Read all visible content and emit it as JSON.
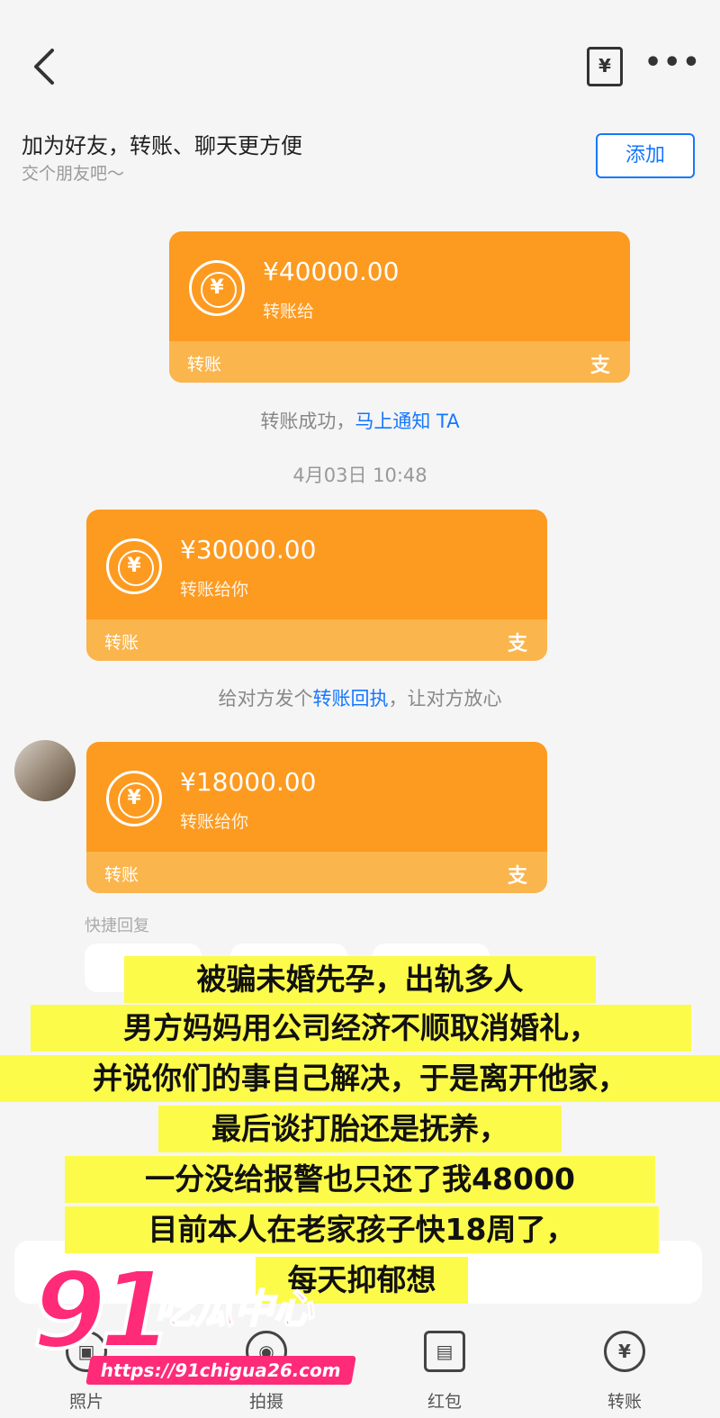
{
  "header": {
    "back_icon": "chevron-left-icon",
    "bill_icon_glyph": "¥",
    "more_glyph": "•••"
  },
  "friend_bar": {
    "title": "加为好友，转账、聊天更方便",
    "subtitle": "交个朋友吧～",
    "add_label": "添加"
  },
  "transfers": [
    {
      "amount": "¥40000.00",
      "desc": "转账给",
      "label": "转账",
      "badge": "支"
    },
    {
      "amount": "¥30000.00",
      "desc": "转账给你",
      "label": "转账",
      "badge": "支"
    },
    {
      "amount": "¥18000.00",
      "desc": "转账给你",
      "label": "转账",
      "badge": "支"
    }
  ],
  "system": {
    "success_text": "转账成功，",
    "notify_link": "马上通知 TA",
    "timestamp": "4月03日 10:48",
    "receipt_prefix": "给对方发个",
    "receipt_link": "转账回执",
    "receipt_suffix": "，让对方放心"
  },
  "quick_reply_label": "快捷回复",
  "bottom_nav": [
    {
      "icon": "photo-icon",
      "label": "照片"
    },
    {
      "icon": "camera-icon",
      "label": "拍摄"
    },
    {
      "icon": "red-packet-icon",
      "label": "红包"
    },
    {
      "icon": "transfer-icon",
      "label": "转账"
    }
  ],
  "overlay_lines": [
    "被骗未婚先孕，出轨多人",
    "男方妈妈用公司经济不顺取消婚礼，",
    "并说你们的事自己解决，于是离开他家，",
    "最后谈打胎还是抚养，",
    "一分没给报警也只还了我48000",
    "目前本人在老家孩子快18周了，",
    "每天抑郁想"
  ],
  "watermark": {
    "number": "91",
    "name": "吃瓜中心",
    "url": "https://91chigua26.com"
  },
  "colors": {
    "card_orange": "#fd9a20",
    "card_bottom": "#fbb54d",
    "link_blue": "#1677ff",
    "highlight_yellow": "#fcfb4a",
    "watermark_pink": "#ff2a78"
  }
}
